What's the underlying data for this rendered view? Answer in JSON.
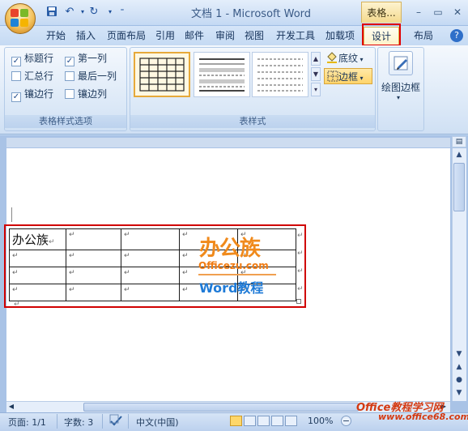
{
  "window": {
    "title": "文档 1 - Microsoft Word",
    "context_tab_label": "表格...",
    "minimize": "–",
    "restore": "▭",
    "close": "✕"
  },
  "quick_access": {
    "icons": [
      "save-icon",
      "undo-icon",
      "redo-icon",
      "customize-icon"
    ]
  },
  "tabs": [
    {
      "label": "开始"
    },
    {
      "label": "插入"
    },
    {
      "label": "页面布局"
    },
    {
      "label": "引用"
    },
    {
      "label": "邮件"
    },
    {
      "label": "审阅"
    },
    {
      "label": "视图"
    },
    {
      "label": "开发工具"
    },
    {
      "label": "加载项"
    },
    {
      "label": "设计"
    },
    {
      "label": "布局"
    }
  ],
  "help_icon": "?",
  "ribbon": {
    "style_options": {
      "label": "表格样式选项",
      "options": [
        {
          "label": "标题行",
          "checked": true
        },
        {
          "label": "第一列",
          "checked": true
        },
        {
          "label": "汇总行",
          "checked": false
        },
        {
          "label": "最后一列",
          "checked": false
        },
        {
          "label": "镶边行",
          "checked": true
        },
        {
          "label": "镶边列",
          "checked": false
        }
      ]
    },
    "table_styles": {
      "label": "表样式",
      "shading_label": "底纹",
      "border_label": "边框"
    },
    "draw_borders": {
      "label": "绘图边框"
    }
  },
  "document": {
    "table": {
      "rows": [
        [
          "办公族",
          "",
          "",
          "",
          "",
          ""
        ],
        [
          "",
          "",
          "",
          "",
          "",
          ""
        ],
        [
          "",
          "",
          "",
          "",
          "",
          ""
        ],
        [
          "",
          "",
          "",
          "",
          "",
          ""
        ]
      ],
      "cell_mark": "↵"
    },
    "watermark": {
      "line1": "办公族",
      "line2": "Officezu.com",
      "line3": "Word教程"
    }
  },
  "status_bar": {
    "page": "页面: 1/1",
    "words": "字数: 3",
    "language": "中文(中国)",
    "zoom": "100%",
    "site_line1": "Office教程学习网",
    "site_line2": "www.office68.com"
  },
  "colors": {
    "highlight_red": "#e00000",
    "ribbon_blue": "#dbe8f7",
    "watermark_orange": "#f08a1c",
    "watermark_blue": "#1f7bd7"
  }
}
